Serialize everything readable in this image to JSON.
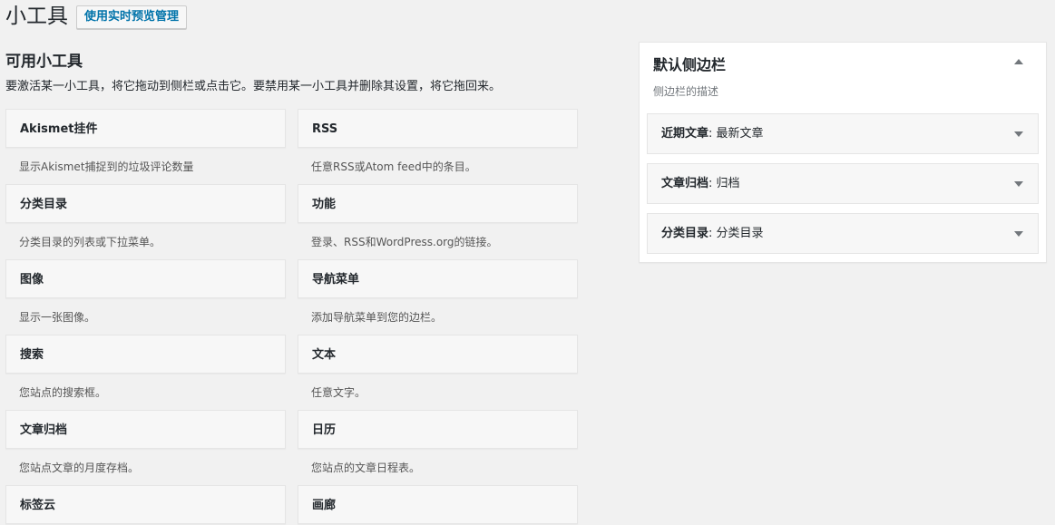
{
  "header": {
    "title": "小工具",
    "manage_button": "使用实时预览管理"
  },
  "available": {
    "heading": "可用小工具",
    "description": "要激活某一小工具，将它拖动到侧栏或点击它。要禁用某一小工具并删除其设置，将它拖回来。"
  },
  "widgets": [
    {
      "name": "Akismet挂件",
      "description": "显示Akismet捕捉到的垃圾评论数量"
    },
    {
      "name": "RSS",
      "description": "任意RSS或Atom feed中的条目。"
    },
    {
      "name": "分类目录",
      "description": "分类目录的列表或下拉菜单。"
    },
    {
      "name": "功能",
      "description": "登录、RSS和WordPress.org的链接。"
    },
    {
      "name": "图像",
      "description": "显示一张图像。"
    },
    {
      "name": "导航菜单",
      "description": "添加导航菜单到您的边栏。"
    },
    {
      "name": "搜索",
      "description": "您站点的搜索框。"
    },
    {
      "name": "文本",
      "description": "任意文字。"
    },
    {
      "name": "文章归档",
      "description": "您站点文章的月度存档。"
    },
    {
      "name": "日历",
      "description": "您站点的文章日程表。"
    },
    {
      "name": "标签云",
      "description": ""
    },
    {
      "name": "画廊",
      "description": ""
    }
  ],
  "sidebar": {
    "title": "默认侧边栏",
    "description": "侧边栏的描述",
    "widgets": [
      {
        "name": "近期文章",
        "title": ": 最新文章"
      },
      {
        "name": "文章归档",
        "title": ": 归档"
      },
      {
        "name": "分类目录",
        "title": ": 分类目录"
      }
    ]
  },
  "icons": {
    "sidebar_toggle": "arrow-up-icon",
    "widget_expand": "arrow-down-icon"
  },
  "colors": {
    "background": "#f1f1f1",
    "text": "#23282d",
    "link": "#0073aa",
    "muted": "#72777c"
  }
}
